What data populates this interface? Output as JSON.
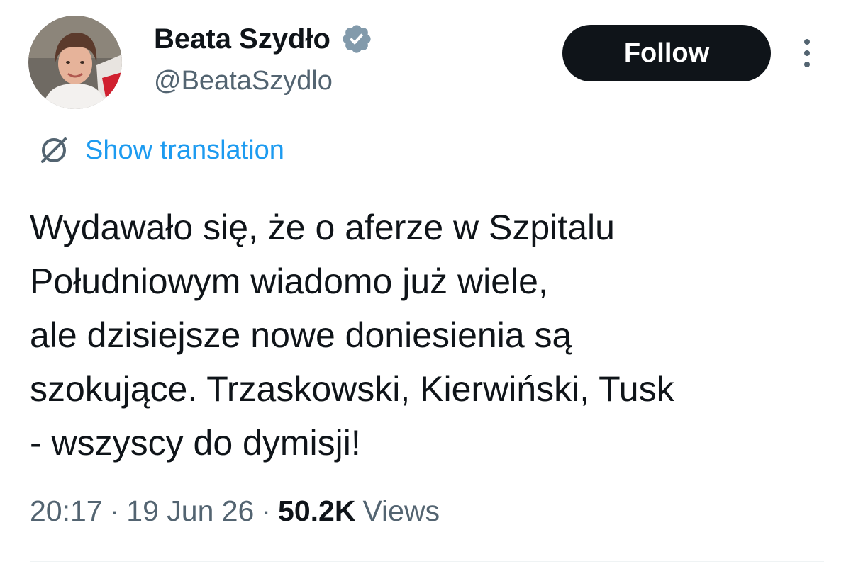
{
  "author": {
    "display_name": "Beata Szydło",
    "handle": "@BeataSzydlo",
    "verified_badge_icon": "verified-badge-icon",
    "badge_color": "#829aab"
  },
  "actions": {
    "follow_label": "Follow",
    "more_icon": "more-vertical-icon"
  },
  "translation": {
    "icon": "translate-icon",
    "link_label": "Show translation"
  },
  "tweet": {
    "lines": [
      "Wydawało się, że o aferze w Szpitalu",
      "Południowym wiadomo już wiele,",
      "ale dzisiejsze nowe doniesienia są",
      "szokujące. Trzaskowski, Kierwiński, Tusk",
      "- wszyscy do dymisji!"
    ]
  },
  "meta": {
    "time": "20:17",
    "separator": "·",
    "date": "19 Jun 26",
    "views_count": "50.2K",
    "views_label": "Views"
  },
  "colors": {
    "text_primary": "#0f1419",
    "text_secondary": "#536471",
    "link": "#1d9bf0",
    "button_bg": "#0f1419"
  }
}
